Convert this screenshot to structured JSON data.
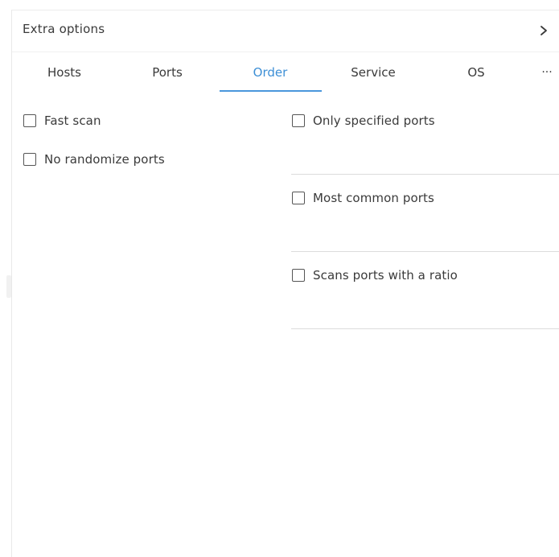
{
  "header": {
    "title": "Extra options",
    "chevron_icon": "chevron-right-icon"
  },
  "tabs": [
    {
      "label": "Hosts",
      "active": false
    },
    {
      "label": "Ports",
      "active": false
    },
    {
      "label": "Order",
      "active": true
    },
    {
      "label": "Service",
      "active": false
    },
    {
      "label": "OS",
      "active": false
    }
  ],
  "tabs_more": "···",
  "options_left": [
    {
      "label": "Fast scan",
      "checked": false
    },
    {
      "label": "No randomize ports",
      "checked": false
    }
  ],
  "options_right": [
    {
      "label": "Only specified ports",
      "checked": false
    },
    {
      "label": "Most common ports",
      "checked": false
    },
    {
      "label": "Scans ports with a ratio",
      "checked": false
    }
  ],
  "colors": {
    "accent": "#3d8fd6",
    "text": "#3a3a3a",
    "divider": "#dcdcdc"
  }
}
